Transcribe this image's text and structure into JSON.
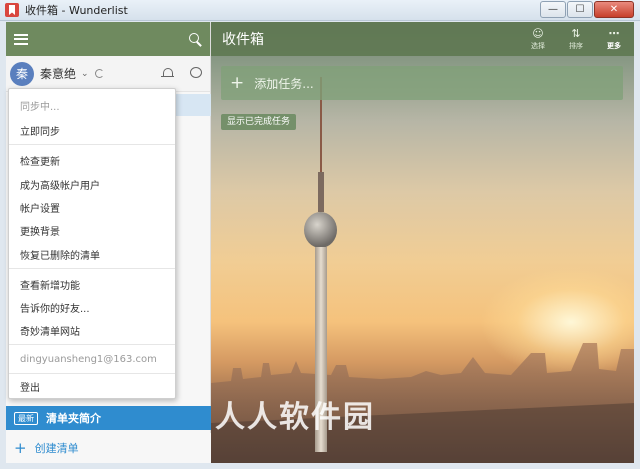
{
  "window": {
    "title": "收件箱 - Wunderlist"
  },
  "sidebar": {
    "user": {
      "avatar_initial": "秦",
      "name": "秦意绝"
    },
    "bottom_list": {
      "badge": "最新",
      "label": "清单夹简介"
    },
    "create_list_label": "创建清单"
  },
  "menu": {
    "items": [
      {
        "label": "同步中..."
      },
      {
        "label": "立即同步"
      },
      {
        "label": "检查更新"
      },
      {
        "label": "成为高级帐户用户"
      },
      {
        "label": "帐户设置"
      },
      {
        "label": "更换背景"
      },
      {
        "label": "恢复已删除的清单"
      },
      {
        "label": "查看新增功能"
      },
      {
        "label": "告诉你的好友..."
      },
      {
        "label": "奇妙清单网站"
      },
      {
        "label": "dingyuansheng1@163.com"
      },
      {
        "label": "登出"
      }
    ]
  },
  "main": {
    "title": "收件箱",
    "toolbar": {
      "share": "选择",
      "sort": "排序",
      "more": "更多"
    },
    "add_task_placeholder": "添加任务...",
    "show_completed": "显示已完成任务"
  },
  "watermark": "人人软件园"
}
